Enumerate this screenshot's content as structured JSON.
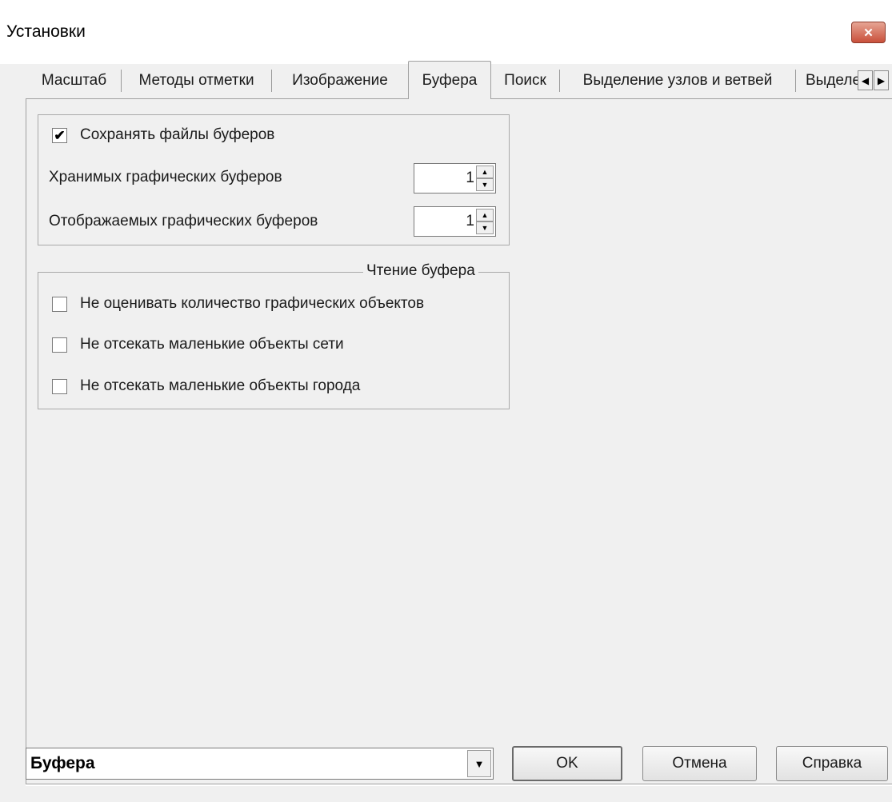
{
  "window": {
    "title": "Установки",
    "close_glyph": "✕"
  },
  "tabs": [
    {
      "label": "Масштаб",
      "active": false
    },
    {
      "label": "Методы отметки",
      "active": false
    },
    {
      "label": "Изображение",
      "active": false
    },
    {
      "label": "Буфера",
      "active": true
    },
    {
      "label": "Поиск",
      "active": false
    },
    {
      "label": "Выделение узлов и ветвей",
      "active": false
    },
    {
      "label": "Выделение",
      "active": false
    }
  ],
  "tab_scroll": {
    "left": "◀",
    "right": "▶"
  },
  "buffers_group": {
    "save_files": {
      "label": "Сохранять файлы буферов",
      "checked": true,
      "mark": "✔"
    },
    "stored_graphic_buffers": {
      "label": "Хранимых графических буферов",
      "value": "1"
    },
    "displayed_graphic_buffers": {
      "label": "Отображаемых графических буферов",
      "value": "1"
    },
    "spin_up": "▲",
    "spin_down": "▼"
  },
  "reading_group": {
    "legend": "Чтение буфера",
    "options": [
      {
        "label": "Не оценивать количество графических объектов",
        "checked": false
      },
      {
        "label": "Не отсекать маленькие объекты сети",
        "checked": false
      },
      {
        "label": "Не отсекать маленькие объекты города",
        "checked": false
      }
    ]
  },
  "footer": {
    "page_select": {
      "value": "Буфера",
      "arrow": "▼"
    },
    "ok_label": "OK",
    "cancel_label": "Отмена",
    "help_label": "Справка"
  }
}
